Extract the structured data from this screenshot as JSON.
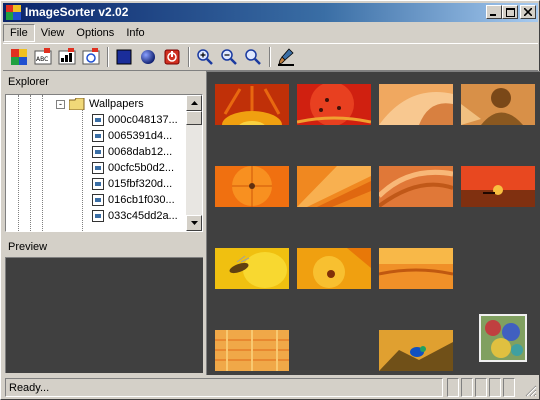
{
  "window": {
    "title": "ImageSorter v2.02"
  },
  "menu": [
    {
      "label": "File",
      "active": true
    },
    {
      "label": "View",
      "active": false
    },
    {
      "label": "Options",
      "active": false
    },
    {
      "label": "Info",
      "active": false
    }
  ],
  "toolbar": {
    "buttons": [
      "sort-by-color-icon",
      "sort-by-name-icon",
      "sort-by-size-icon",
      "sort-by-date-icon",
      "square-view-icon",
      "sphere-view-icon",
      "reset-icon",
      "zoom-in-icon",
      "zoom-out-icon",
      "zoom-fit-icon",
      "brush-icon"
    ]
  },
  "explorer": {
    "label": "Explorer",
    "folder": {
      "name": "Wallpapers",
      "expander": "-"
    },
    "files": [
      "000c048137...",
      "0065391d4...",
      "0068dab12...",
      "00cfc5b0d2...",
      "015fbf320d...",
      "016cb1f030...",
      "033c45dd2a..."
    ]
  },
  "preview": {
    "label": "Preview"
  },
  "status": {
    "text": "Ready..."
  },
  "colors": {
    "titlebar_start": "#0a246a",
    "titlebar_end": "#a6caf0",
    "canvas": "#404040",
    "face": "#d4d0c8"
  }
}
